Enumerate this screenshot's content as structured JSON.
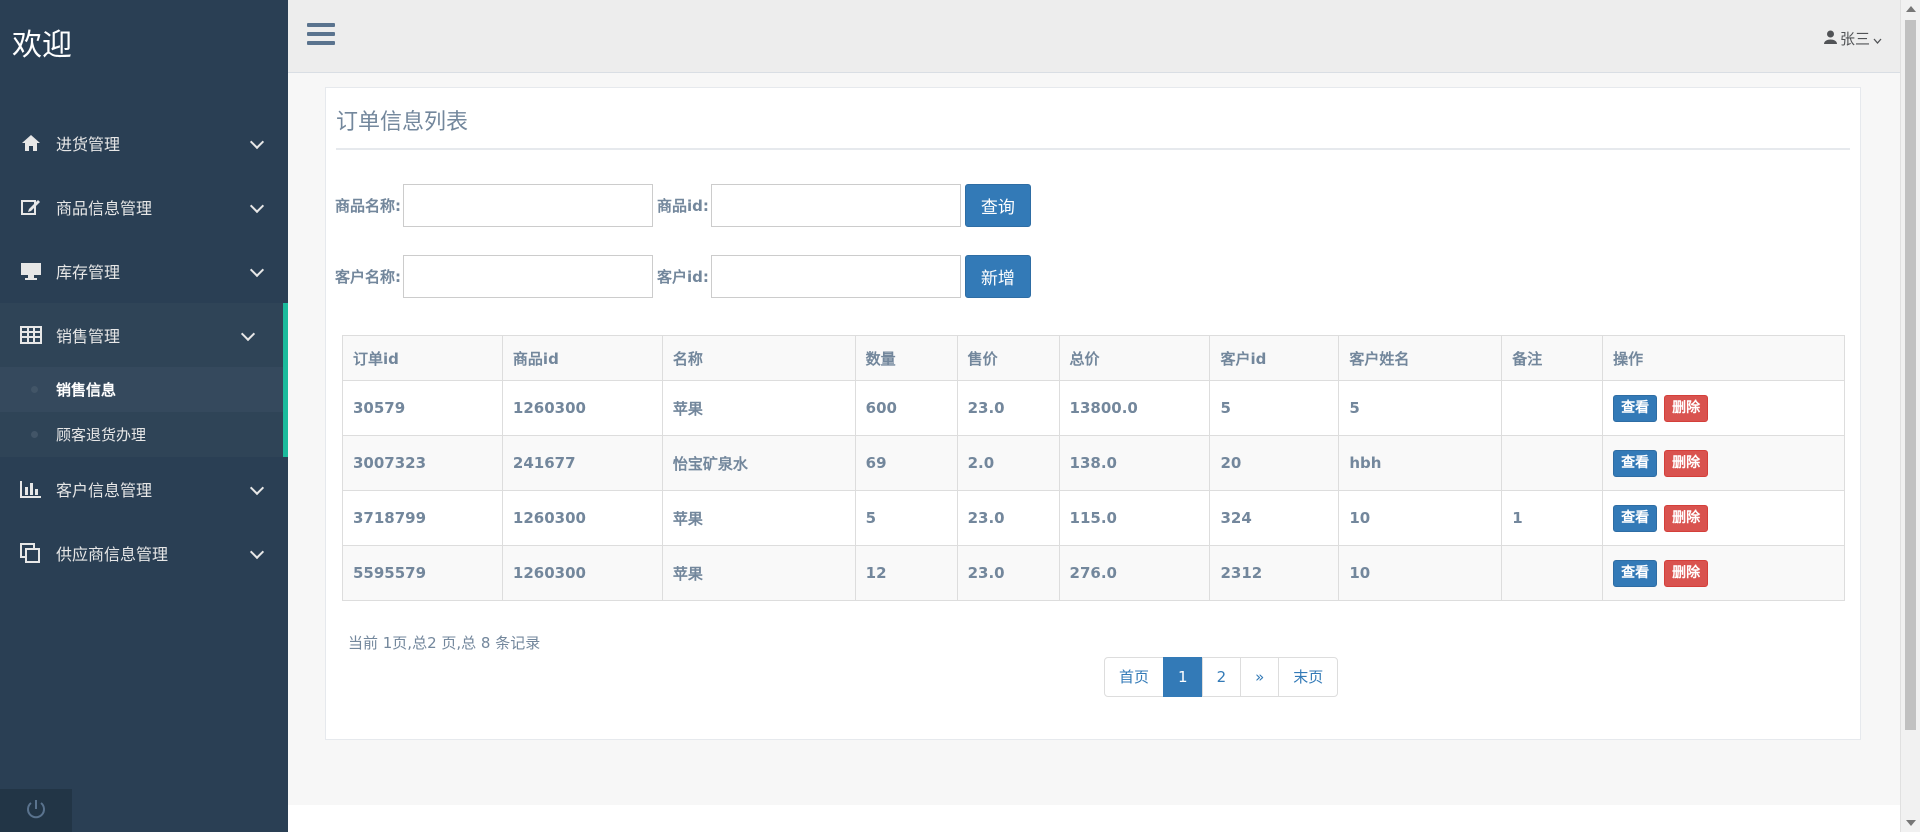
{
  "brand": "欢迎",
  "sidebar": {
    "items": [
      {
        "label": "进货管理",
        "icon": "home-icon"
      },
      {
        "label": "商品信息管理",
        "icon": "edit-icon"
      },
      {
        "label": "库存管理",
        "icon": "desktop-icon"
      },
      {
        "label": "销售管理",
        "icon": "table-icon"
      },
      {
        "label": "客户信息管理",
        "icon": "bar-chart-icon"
      },
      {
        "label": "供应商信息管理",
        "icon": "copy-icon"
      }
    ],
    "sub_items": [
      {
        "label": "销售信息"
      },
      {
        "label": "顾客退货办理"
      }
    ]
  },
  "topbar": {
    "user": "张三"
  },
  "panel": {
    "title": "订单信息列表",
    "fields": {
      "product_name_label": "商品名称:",
      "product_id_label": "商品id:",
      "customer_name_label": "客户名称:",
      "customer_id_label": "客户id:"
    },
    "query_button": "查询",
    "add_button": "新增"
  },
  "table": {
    "headers": [
      "订单id",
      "商品id",
      "名称",
      "数量",
      "售价",
      "总价",
      "客户id",
      "客户姓名",
      "备注",
      "操作"
    ],
    "rows": [
      {
        "order_id": "30579",
        "product_id": "1260300",
        "name": "苹果",
        "qty": "600",
        "price": "23.0",
        "total": "13800.0",
        "customer_id": "5",
        "customer_name": "5",
        "note": ""
      },
      {
        "order_id": "3007323",
        "product_id": "241677",
        "name": "怡宝矿泉水",
        "qty": "69",
        "price": "2.0",
        "total": "138.0",
        "customer_id": "20",
        "customer_name": "hbh",
        "note": ""
      },
      {
        "order_id": "3718799",
        "product_id": "1260300",
        "name": "苹果",
        "qty": "5",
        "price": "23.0",
        "total": "115.0",
        "customer_id": "324",
        "customer_name": "10",
        "note": "1"
      },
      {
        "order_id": "5595579",
        "product_id": "1260300",
        "name": "苹果",
        "qty": "12",
        "price": "23.0",
        "total": "276.0",
        "customer_id": "2312",
        "customer_name": "10",
        "note": ""
      }
    ],
    "view_label": "查看",
    "delete_label": "删除"
  },
  "summary": "当前 1页,总2 页,总 8 条记录",
  "pagination": {
    "first": "首页",
    "p1": "1",
    "p2": "2",
    "next": "»",
    "last": "末页"
  },
  "colors": {
    "sidebar": "#2a3f54",
    "accent": "#1abb9c",
    "primary": "#337ab7",
    "danger": "#d9534f"
  }
}
